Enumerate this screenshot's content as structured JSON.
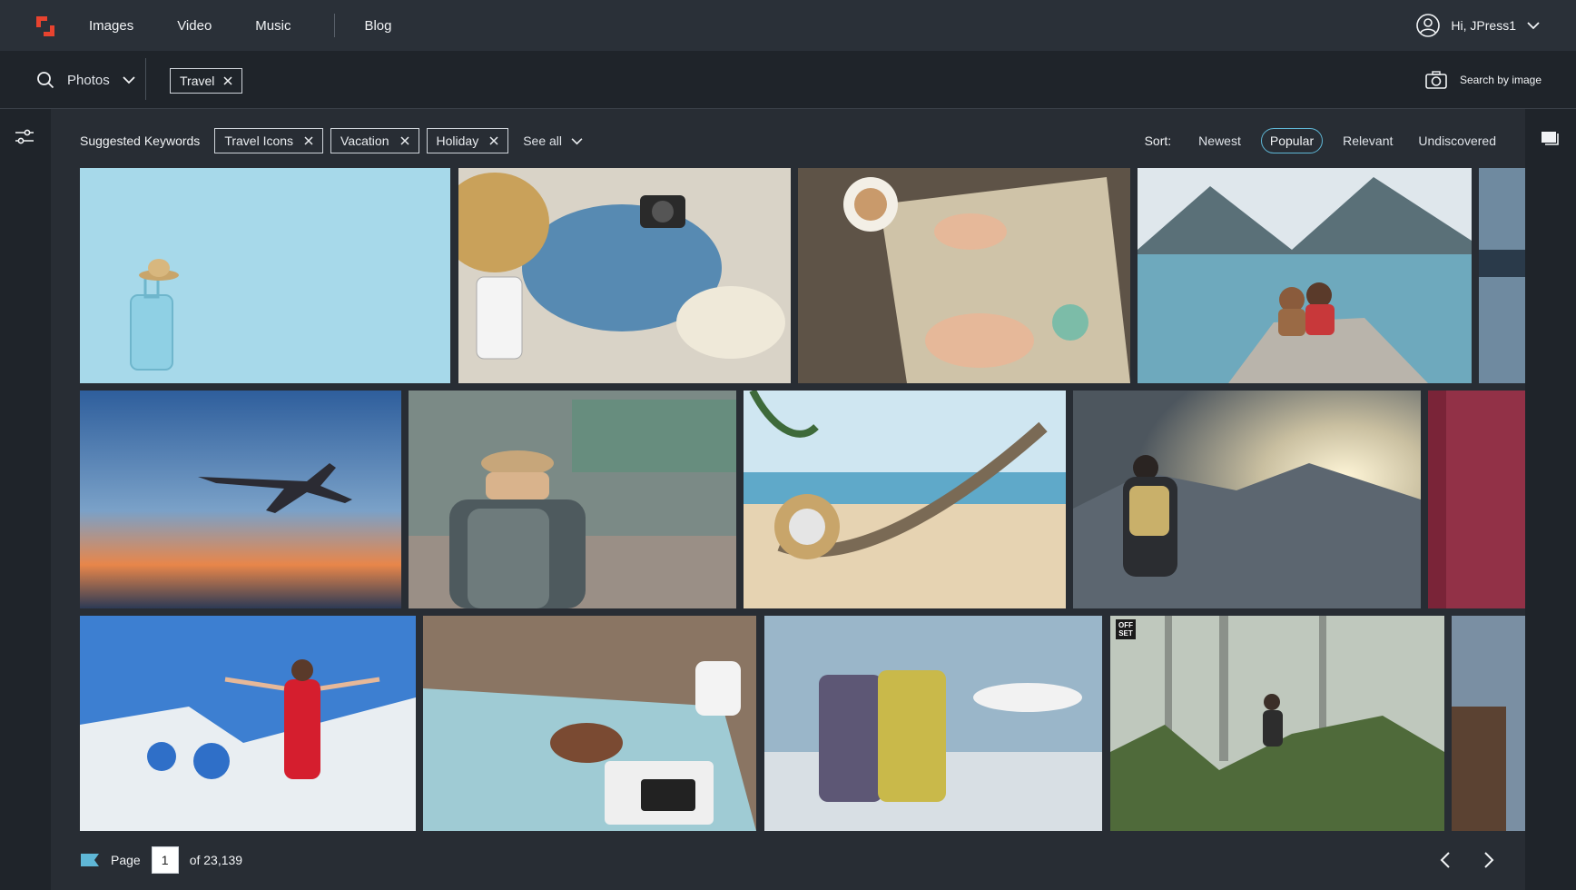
{
  "nav": {
    "links": [
      "Images",
      "Video",
      "Music",
      "Blog"
    ],
    "user_greeting": "Hi, JPress1"
  },
  "search": {
    "type": "Photos",
    "query_chip": "Travel",
    "search_by_image": "Search by image"
  },
  "keywords": {
    "title": "Suggested Keywords",
    "items": [
      "Travel Icons",
      "Vacation",
      "Holiday"
    ],
    "see_all": "See all"
  },
  "sort": {
    "label": "Sort:",
    "options": [
      "Newest",
      "Popular",
      "Relevant",
      "Undiscovered"
    ],
    "active": "Popular"
  },
  "tiles": [
    {
      "name": "suitcase-hat-blue-wall",
      "colors": [
        "#a7d9ea",
        "#8ccfe4"
      ]
    },
    {
      "name": "travel-flatlay-map-camera",
      "colors": [
        "#d9d3c7",
        "#3f7cae"
      ]
    },
    {
      "name": "hands-on-map-coffee",
      "colors": [
        "#5e5347",
        "#cfc3a8"
      ]
    },
    {
      "name": "couple-mountain-lake",
      "colors": [
        "#6ea9bd",
        "#3c5a62"
      ]
    },
    {
      "name": "partial-edge-1",
      "colors": [
        "#2a3a4a",
        "#6f8aa0"
      ]
    },
    {
      "name": "airplane-sunset",
      "colors": [
        "#3b6aa7",
        "#e8864a"
      ]
    },
    {
      "name": "backpacker-street-market",
      "colors": [
        "#7b8a86",
        "#c7a67a"
      ]
    },
    {
      "name": "hammock-beach",
      "colors": [
        "#cfe6f1",
        "#e6d3b2"
      ]
    },
    {
      "name": "hiker-mountain-sun",
      "colors": [
        "#5c6670",
        "#f2e2b8"
      ]
    },
    {
      "name": "partial-edge-2",
      "colors": [
        "#7a2438",
        "#a23a52"
      ]
    },
    {
      "name": "santorini-red-dress",
      "colors": [
        "#3d7fd1",
        "#e9eef2"
      ]
    },
    {
      "name": "map-hand-mug",
      "colors": [
        "#8a7563",
        "#9fcbd4"
      ]
    },
    {
      "name": "luggage-airport",
      "colors": [
        "#9ab6c9",
        "#c9b94a"
      ]
    },
    {
      "name": "hiker-forest-ferns",
      "colors": [
        "#bfc8bd",
        "#4f6a3a"
      ]
    },
    {
      "name": "partial-edge-3",
      "colors": [
        "#7a8fa3",
        "#5b4232"
      ]
    }
  ],
  "offset_badge": "OFF SET",
  "pager": {
    "label": "Page",
    "current": "1",
    "total": "of 23,139"
  }
}
